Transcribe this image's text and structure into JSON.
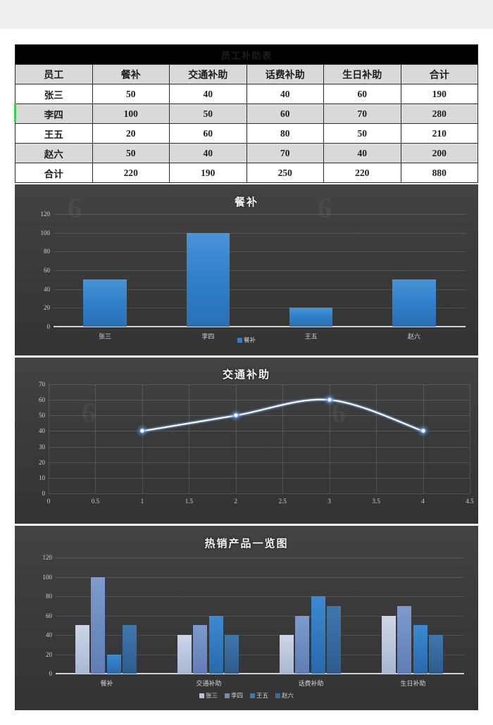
{
  "document": {
    "title": "员工补助表"
  },
  "table": {
    "title": "员工补助表",
    "headers": [
      "员工",
      "餐补",
      "交通补助",
      "话费补助",
      "生日补助",
      "合计"
    ],
    "rows": [
      {
        "name": "张三",
        "meal": "50",
        "transport": "40",
        "phone": "40",
        "birthday": "60",
        "total": "190"
      },
      {
        "name": "李四",
        "meal": "100",
        "transport": "50",
        "phone": "60",
        "birthday": "70",
        "total": "280"
      },
      {
        "name": "王五",
        "meal": "20",
        "transport": "60",
        "phone": "80",
        "birthday": "50",
        "total": "210"
      },
      {
        "name": "赵六",
        "meal": "50",
        "transport": "40",
        "phone": "70",
        "birthday": "40",
        "total": "200"
      },
      {
        "name": "合计",
        "meal": "220",
        "transport": "190",
        "phone": "250",
        "birthday": "220",
        "total": "880"
      }
    ],
    "selected_row_marker": "李四"
  },
  "colors": {
    "title_bar": "#000000",
    "header_fill": "#d9d9d9",
    "chart_bg": "#3a3a3a",
    "bar_blue": "#2f7fc9",
    "series_1": "#b8c4dc",
    "series_2": "#6e8cc0",
    "series_3": "#2e7cc4",
    "series_4": "#356ba0",
    "line_color": "#ffffff",
    "selection_green": "#3fcc50"
  },
  "chart_data": [
    {
      "type": "bar",
      "title": "餐补",
      "categories": [
        "张三",
        "李四",
        "王五",
        "赵六"
      ],
      "values": [
        50,
        100,
        20,
        50
      ],
      "legend": [
        "餐补"
      ],
      "legend_position": "bottom",
      "xlabel": "",
      "ylabel": "",
      "ylim": [
        0,
        120
      ],
      "yticks": [
        0,
        20,
        40,
        60,
        80,
        100,
        120
      ],
      "grid": true
    },
    {
      "type": "line",
      "title": "交通补助",
      "x": [
        1,
        2,
        3,
        4
      ],
      "values": [
        40,
        50,
        60,
        40
      ],
      "xlim": [
        0,
        4.5
      ],
      "xticks": [
        0,
        0.5,
        1,
        1.5,
        2,
        2.5,
        3,
        3.5,
        4,
        4.5
      ],
      "xtick_labels": [
        "0",
        "0.5",
        "1",
        "1.5",
        "2",
        "2.5",
        "3",
        "3.5",
        "4",
        "4.5"
      ],
      "ylim": [
        0,
        70
      ],
      "yticks": [
        0,
        10,
        20,
        30,
        40,
        50,
        60,
        70
      ],
      "xlabel": "",
      "ylabel": "",
      "grid": true,
      "smooth": true,
      "legend": []
    },
    {
      "type": "bar",
      "title": "热销产品一览图",
      "categories": [
        "餐补",
        "交通补助",
        "话费补助",
        "生日补助"
      ],
      "series": [
        {
          "name": "张三",
          "values": [
            50,
            40,
            40,
            60
          ]
        },
        {
          "name": "李四",
          "values": [
            100,
            50,
            60,
            70
          ]
        },
        {
          "name": "王五",
          "values": [
            20,
            60,
            80,
            50
          ]
        },
        {
          "name": "赵六",
          "values": [
            50,
            40,
            70,
            40
          ]
        }
      ],
      "ylim": [
        0,
        120
      ],
      "yticks": [
        0,
        20,
        40,
        60,
        80,
        100,
        120
      ],
      "xlabel": "",
      "ylabel": "",
      "grid": true,
      "legend": [
        "张三",
        "李四",
        "王五",
        "赵六"
      ],
      "legend_position": "bottom"
    }
  ]
}
